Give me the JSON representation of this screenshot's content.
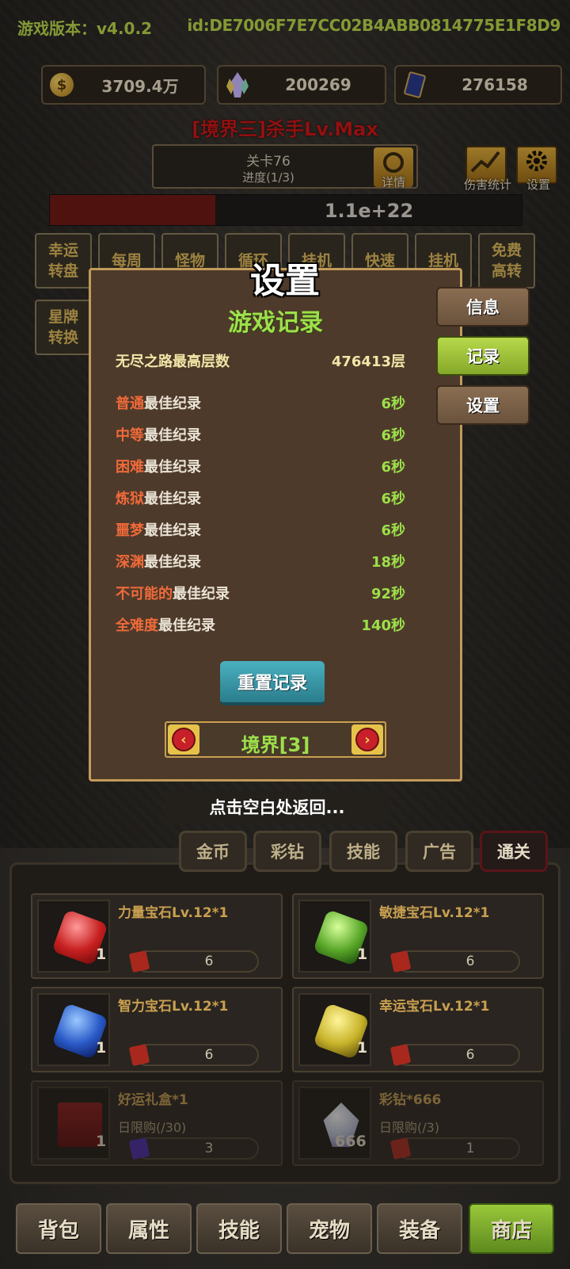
{
  "header": {
    "version": "游戏版本：v4.0.2",
    "id": "id:DE7006F7E7CC02B4ABB0814775E1F8D9"
  },
  "resources": [
    {
      "icon": "coin-icon",
      "value": "3709.4万"
    },
    {
      "icon": "crystal-icon",
      "value": "200269"
    },
    {
      "icon": "card-icon",
      "value": "276158"
    }
  ],
  "realm_title": "[境界三]杀手Lv.Max",
  "stage": {
    "name": "关卡76",
    "progress": "进度(1/3)",
    "detail_label": "详情"
  },
  "top_icons": {
    "damage_stats": "伤害统计",
    "settings": "设置"
  },
  "boss_hp": {
    "value": "1.1e+22",
    "fraction": 0.35
  },
  "feature_buttons": [
    {
      "l1": "幸运",
      "l2": "转盘"
    },
    {
      "l1": "每周",
      "l2": ""
    },
    {
      "l1": "怪物",
      "l2": ""
    },
    {
      "l1": "循环",
      "l2": ""
    },
    {
      "l1": "挂机",
      "l2": ""
    },
    {
      "l1": "快速",
      "l2": ""
    },
    {
      "l1": "挂机",
      "l2": ""
    },
    {
      "l1": "免费",
      "l2": "高转"
    },
    {
      "l1": "星牌",
      "l2": "转换"
    }
  ],
  "dialog": {
    "title": "设置",
    "section_title": "游戏记录",
    "endless_label": "无尽之路最高层数",
    "endless_value": "476413层",
    "best_suffix": "最佳纪录",
    "records": [
      {
        "difficulty": "普通",
        "time": "6秒"
      },
      {
        "difficulty": "中等",
        "time": "6秒"
      },
      {
        "difficulty": "困难",
        "time": "6秒"
      },
      {
        "difficulty": "炼狱",
        "time": "6秒"
      },
      {
        "difficulty": "噩梦",
        "time": "6秒"
      },
      {
        "difficulty": "深渊",
        "time": "18秒"
      },
      {
        "difficulty": "不可能的",
        "time": "92秒"
      },
      {
        "difficulty": "全难度",
        "time": "140秒"
      }
    ],
    "reset_label": "重置记录",
    "realm_selector": "境界[3]",
    "prev_arrow": "‹",
    "next_arrow": "›",
    "side_tabs": {
      "info": "信息",
      "records": "记录",
      "settings": "设置"
    },
    "dismiss_hint": "点击空白处返回..."
  },
  "shop": {
    "tabs": [
      "金币",
      "彩钻",
      "技能",
      "广告",
      "通关"
    ],
    "active_tab": "通关",
    "items": [
      {
        "name": "力量宝石Lv.12*1",
        "count": "1",
        "price": "6",
        "color": "#c82020",
        "sub": ""
      },
      {
        "name": "敏捷宝石Lv.12*1",
        "count": "1",
        "price": "6",
        "color": "#5aa82a",
        "sub": ""
      },
      {
        "name": "智力宝石Lv.12*1",
        "count": "1",
        "price": "6",
        "color": "#2a5ac8",
        "sub": ""
      },
      {
        "name": "幸运宝石Lv.12*1",
        "count": "1",
        "price": "6",
        "color": "#c8b42a",
        "sub": ""
      },
      {
        "name": "好运礼盒*1",
        "count": "1",
        "price": "3",
        "color": "#8a1a1a",
        "sub": "日限购(/30)"
      },
      {
        "name": "彩钻*666",
        "count": "666",
        "price": "1",
        "color": "#b8c0d8",
        "sub": "日限购(/3)"
      }
    ]
  },
  "bottom_nav": [
    "背包",
    "属性",
    "技能",
    "宠物",
    "装备",
    "商店"
  ],
  "active_nav": "商店"
}
